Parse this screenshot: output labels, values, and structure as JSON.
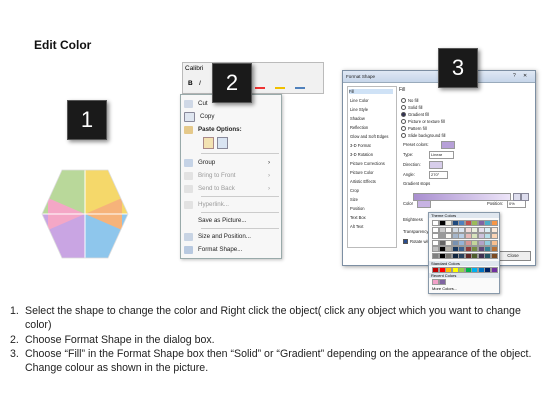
{
  "title": "Edit Color",
  "steps": [
    "1",
    "2",
    "3"
  ],
  "ribbon": {
    "font": "Calibri",
    "bold": "B",
    "italic": "I"
  },
  "context_menu": {
    "items": [
      {
        "label": "Cut",
        "enabled": true
      },
      {
        "label": "Copy",
        "enabled": true
      },
      {
        "label": "Paste Options:",
        "enabled": true,
        "bold": true
      },
      {
        "label": "Group",
        "enabled": true,
        "submenu": true
      },
      {
        "label": "Bring to Front",
        "enabled": false,
        "submenu": true
      },
      {
        "label": "Send to Back",
        "enabled": false,
        "submenu": true
      },
      {
        "label": "Hyperlink...",
        "enabled": false
      },
      {
        "label": "Save as Picture...",
        "enabled": true
      },
      {
        "label": "Size and Position...",
        "enabled": true
      },
      {
        "label": "Format Shape...",
        "enabled": true
      }
    ]
  },
  "dialog": {
    "title": "Format Shape",
    "nav": [
      "Fill",
      "Line Color",
      "Line Style",
      "Shadow",
      "Reflection",
      "Glow and Soft Edges",
      "3-D Format",
      "3-D Rotation",
      "Picture Corrections",
      "Picture Color",
      "Artistic Effects",
      "Crop",
      "Size",
      "Position",
      "Text Box",
      "Alt Text"
    ],
    "fill_header": "Fill",
    "fill_options": [
      "No fill",
      "Solid fill",
      "Gradient fill",
      "Picture or texture fill",
      "Pattern fill",
      "Slide background fill"
    ],
    "preset_colors": "Preset colors:",
    "type_label": "Type:",
    "type_value": "Linear",
    "direction_label": "Direction:",
    "angle_label": "Angle:",
    "angle_value": "270°",
    "gradient_stops": "Gradient stops",
    "color_label": "Color",
    "position_label": "Position:",
    "position_value": "0%",
    "brightness_label": "Brightness",
    "transparency_label": "Transparency",
    "rotate_label": "Rotate with shape",
    "close_label": "Close"
  },
  "palette": {
    "theme_colors": "Theme Colors",
    "standard_colors": "Standard Colors",
    "recent_colors": "Recent Colors",
    "more_colors": "More Colors...",
    "theme_row": [
      "#ffffff",
      "#000000",
      "#eeece1",
      "#1f497d",
      "#4f81bd",
      "#c0504d",
      "#9bbb59",
      "#8064a2",
      "#4bacc6",
      "#f79646"
    ],
    "standard_row": [
      "#c00000",
      "#ff0000",
      "#ffc000",
      "#ffff00",
      "#92d050",
      "#00b050",
      "#00b0f0",
      "#0070c0",
      "#002060",
      "#7030a0"
    ],
    "recent_row": [
      "#f2a0c8",
      "#8064a2"
    ]
  },
  "instructions": [
    {
      "num": "1.",
      "text": "Select the shape to change the color and Right click the object( click any object which you want to change color)"
    },
    {
      "num": "2.",
      "text": "Choose Format Shape in the dialog box."
    },
    {
      "num": "3.",
      "text": "Choose “Fill” in the Format Shape box then “Solid” or “Gradient” depending on the appearance of the object. Change colour as shown in the picture."
    }
  ]
}
